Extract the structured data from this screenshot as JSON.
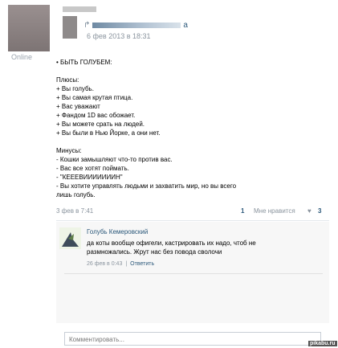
{
  "profile": {
    "online_label": "Online"
  },
  "repost": {
    "date": "6 фев 2013 в 18:31",
    "name_tail": "a"
  },
  "post": {
    "lines": [
      "• БЫТЬ ГОЛУБЕМ:",
      "",
      "Плюсы:",
      "+ Вы голубь.",
      "+ Вы самая крутая птица.",
      "+ Вас уважают",
      "+ Фандом 1D вас обожает.",
      "+ Вы можете срать на людей.",
      "+ Вы были в Нью Йорке, а они нет.",
      "",
      "Минусы:",
      "- Кошки замышляют что-то против вас.",
      "- Вас все хотят поймать.",
      "- \"КЕЕЕВИИИИИИИН\"",
      "- Вы хотите управлять людьми и захватить мир, но вы всего",
      "лишь голубь."
    ],
    "date": "3 фев в 7:41",
    "reposts": "1",
    "like_label": "Мне нравится",
    "likes": "3"
  },
  "comment": {
    "author": "Голубь Кемеровский",
    "text_line1": "да коты вообще офигели, кастрировать их надо, чтоб не",
    "text_line2": "размножались. Жрут нас без повода сволочи",
    "date": "26 фев в 0:43",
    "reply_label": "Ответить"
  },
  "input": {
    "placeholder": "Комментировать..."
  },
  "watermark": "pikabu.ru"
}
